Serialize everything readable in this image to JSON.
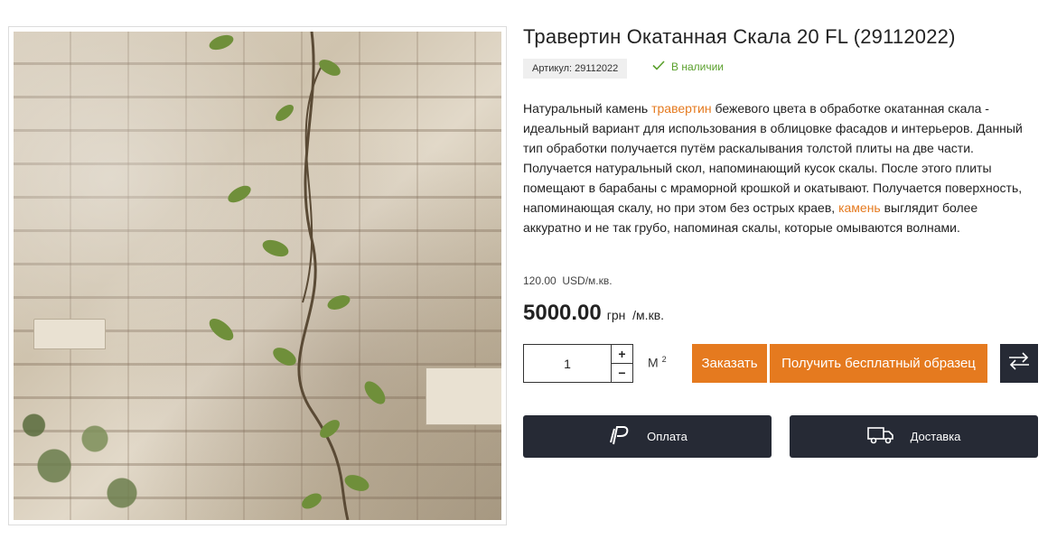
{
  "product": {
    "title": "Травертин Окатанная Скала 20 FL (29112022)",
    "sku": "Артикул: 29112022",
    "stock": "В наличии",
    "description": {
      "p1": "Натуральный камень ",
      "link1": "травертин",
      "p2": " бежевого цвета в обработке окатанная скала - идеальный вариант для использования в облицовке фасадов и интерьеров. Данный тип обработки получается путём раскалывания толстой плиты на две части. Получается натуральный скол, напоминающий кусок скалы. После этого плиты помещают в барабаны с мраморной крошкой и окатывают. Получается поверхность, напоминающая скалу, но при этом без острых краев, ",
      "link2": "камень",
      "p3": " выглядит более аккуратно и не так грубо, напоминая скалы, которые омываются волнами."
    },
    "price_usd": "120.00  USD/м.кв.",
    "price_uah": "5000.00",
    "price_uah_unit": "грн  /м.кв."
  },
  "cart": {
    "quantity": "1",
    "plus": "+",
    "minus": "−",
    "unit": "М",
    "unit_sup": "2",
    "order_button": "Заказать",
    "sample_button": "Получить бесплатный образец"
  },
  "actions": {
    "payment": "Оплата",
    "delivery": "Доставка"
  },
  "colors": {
    "accent": "#e57a1f",
    "dark": "#262a35",
    "in_stock": "#5aa02c"
  }
}
